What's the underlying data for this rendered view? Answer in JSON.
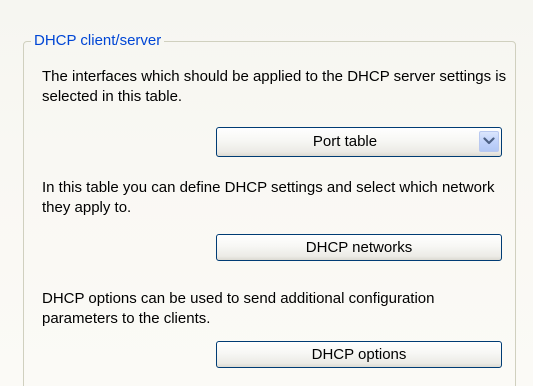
{
  "group": {
    "title": "DHCP client/server"
  },
  "sections": [
    {
      "text": "The interfaces which should be applied to the DHCP server settings is selected in this table.",
      "control_label": "Port table"
    },
    {
      "text": "In this table you can define DHCP settings and select which network they apply to.",
      "control_label": "DHCP networks"
    },
    {
      "text": "DHCP options can be used to send additional configuration parameters to the clients.",
      "control_label": "DHCP options"
    }
  ],
  "icons": {
    "dropdown": "chevron-down-icon"
  },
  "colors": {
    "group_title": "#0046d5",
    "button_border": "#003c74",
    "dropdown_arrow": "#4d6185"
  }
}
